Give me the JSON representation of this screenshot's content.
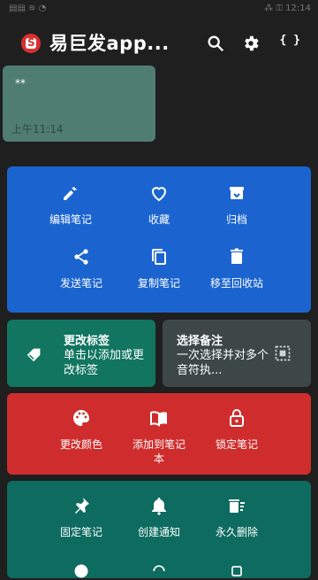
{
  "status": {
    "left": "▤▤ ≋ ◔",
    "right": "⁂ ⚿ 12:14"
  },
  "app": {
    "title": "易巨发app..."
  },
  "note": {
    "title": "**",
    "time": "上午11:14"
  },
  "actions": {
    "edit": "编辑笔记",
    "favorite": "收藏",
    "archive": "归档",
    "send": "发送笔记",
    "copy": "复制笔记",
    "trash": "移至回收站"
  },
  "labels_panel": {
    "title": "更改标签",
    "desc": "单击以添加或更改标签"
  },
  "select_panel": {
    "title": "选择备注",
    "desc": "一次选择并对多个音符执..."
  },
  "red_panel": {
    "color": "更改颜色",
    "notebook": "添加到笔记本",
    "lock": "锁定笔记"
  },
  "bottom_panel": {
    "pin": "固定笔记",
    "notify": "创建通知",
    "delete_forever": "永久删除"
  },
  "colors": {
    "background": "#1f1f1f",
    "note": "#4f7d70",
    "blue": "#1b64d0",
    "teal": "#117560",
    "grey": "#3d4747",
    "red": "#cf2d2d",
    "teal2": "#0d6b5f"
  }
}
